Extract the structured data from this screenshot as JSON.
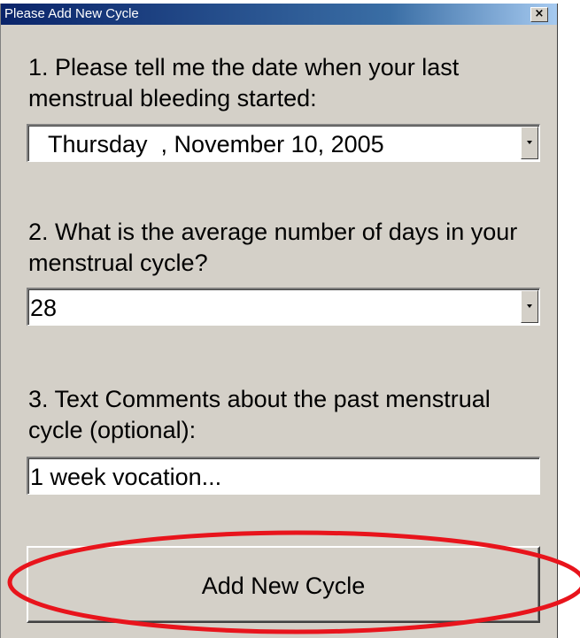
{
  "window": {
    "title": "Please Add New Cycle",
    "close_glyph": "×"
  },
  "question1": {
    "label": "1. Please tell me the date when your last menstrual bleeding started:",
    "value": "Thursday  , November 10, 2005"
  },
  "question2": {
    "label": "2. What is the average number of days in your menstrual cycle?",
    "value": "28"
  },
  "question3": {
    "label": "3. Text Comments about the past menstrual cycle (optional):",
    "value": "1 week vocation..."
  },
  "add_button": {
    "label": "Add New Cycle"
  },
  "colors": {
    "dialog_bg": "#d4d0c8",
    "titlebar_start": "#0a246a",
    "titlebar_end": "#a6caf0",
    "highlight_ring": "#e8141c"
  },
  "icons": {
    "close": "close-icon",
    "dropdown": "chevron-down-icon"
  }
}
